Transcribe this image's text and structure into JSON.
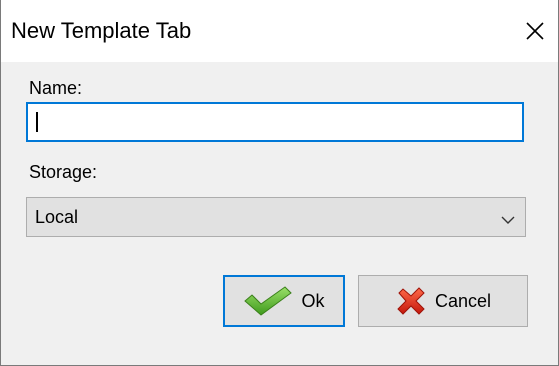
{
  "window": {
    "title": "New Template Tab",
    "close_icon": "close-icon"
  },
  "form": {
    "name_label": "Name:",
    "name_value": "",
    "storage_label": "Storage:",
    "storage_selected": "Local"
  },
  "buttons": {
    "ok_label": "Ok",
    "ok_icon": "checkmark-icon",
    "cancel_label": "Cancel",
    "cancel_icon": "red-x-icon"
  },
  "colors": {
    "focus_border": "#0078d7",
    "dialog_bg": "#f0f0f0",
    "button_bg": "#e1e1e1",
    "ok_icon_green": "#5fb82e",
    "cancel_icon_red": "#e23a2a"
  }
}
